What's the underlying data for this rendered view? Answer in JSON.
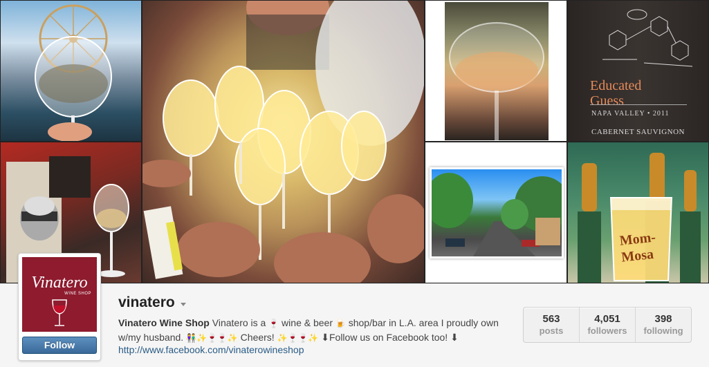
{
  "profile": {
    "username": "vinatero",
    "display_name": "Vinatero Wine Shop",
    "bio_part1": " Vinatero is a ",
    "bio_part2": " wine & beer ",
    "bio_part3": " shop/bar in L.A. area I proudly own w/my husband. ",
    "bio_part4": " Cheers! ",
    "bio_part5": " ⬇Follow us on Facebook too! ⬇",
    "website": "http://www.facebook.com/vinaterowineshop",
    "follow_label": "Follow",
    "avatar_brand": "Vinatero",
    "avatar_shop": "WINE SHOP"
  },
  "stats": [
    {
      "value": "563",
      "label": "posts"
    },
    {
      "value": "4,051",
      "label": "followers"
    },
    {
      "value": "398",
      "label": "following"
    }
  ],
  "emoji": {
    "wine": "🍷",
    "beer": "🍺",
    "couple": "👫",
    "sparkles": "✨",
    "cheers_seq": "✨🍷🍷✨",
    "cheers_seq2": "✨🍷🍷✨"
  },
  "photos": {
    "wine_label_title_line1": "Educated",
    "wine_label_title_line2": "Guess",
    "wine_label_region": "NAPA VALLEY • 2011",
    "wine_label_varietal": "CABERNET SAUVIGNON",
    "mimosa_text_line1": "Mom-",
    "mimosa_text_line2": "Mosa"
  },
  "colors": {
    "brand_red": "#8e1b2e",
    "link_blue": "#2a5b86",
    "follow_blue": "#3a6a9a"
  }
}
